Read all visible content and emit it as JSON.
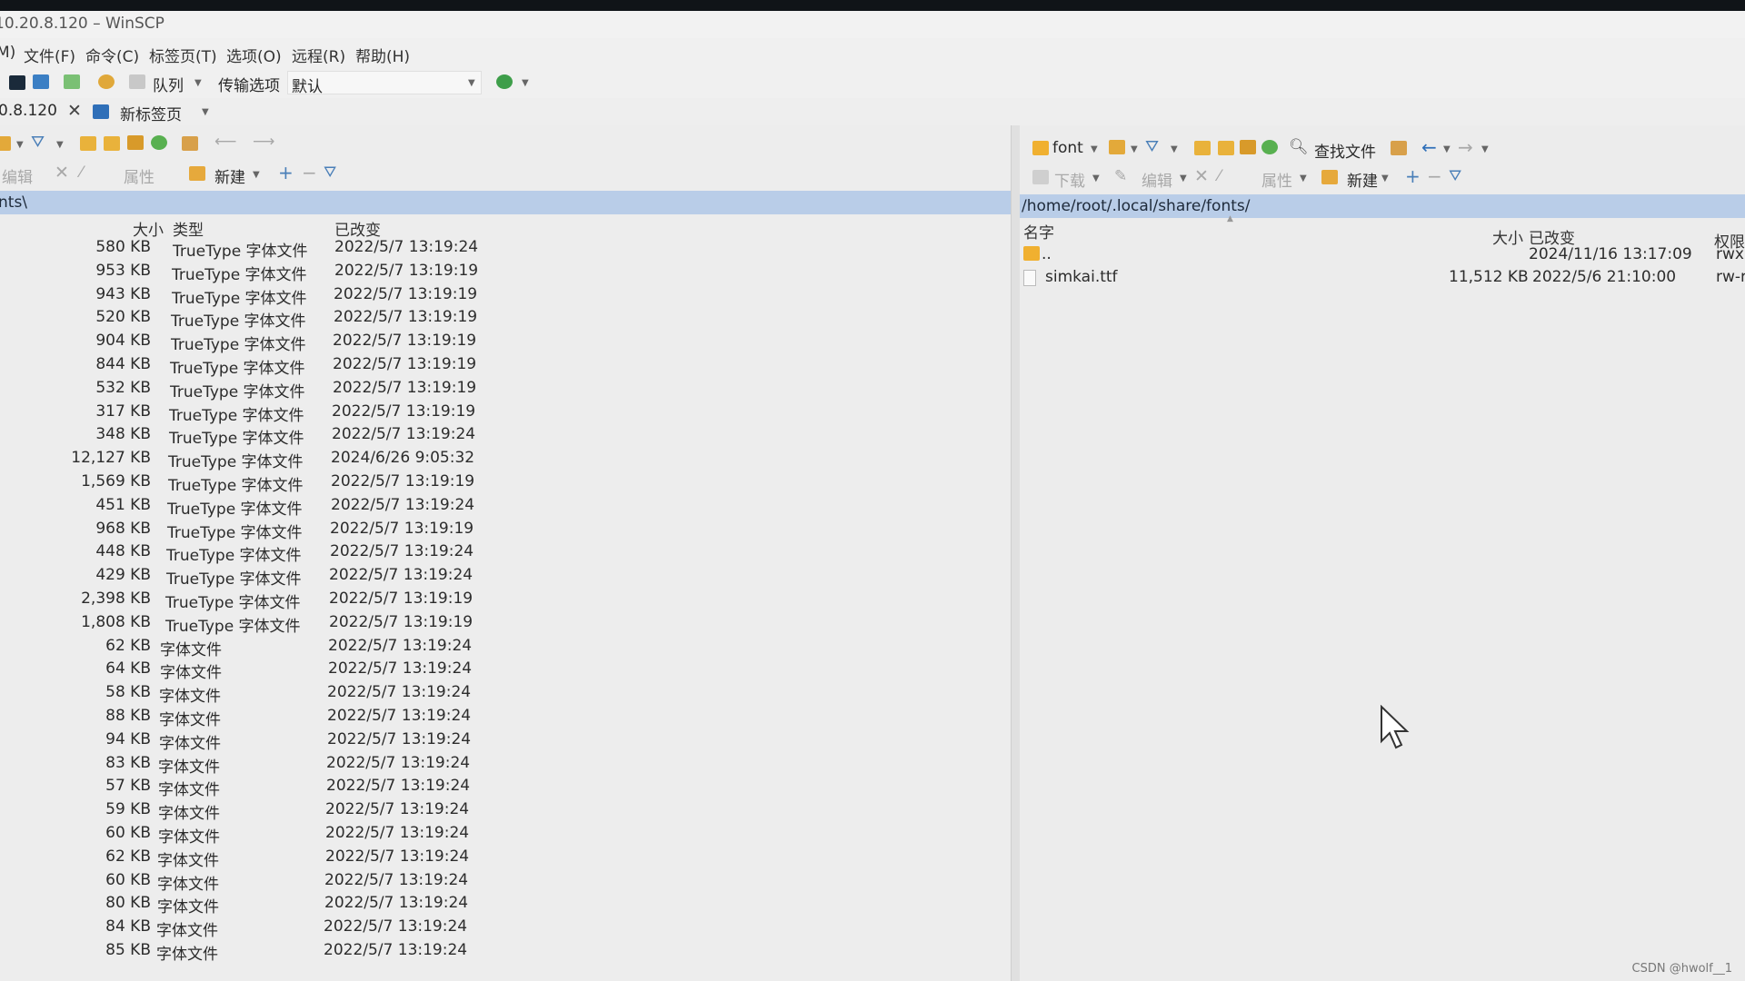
{
  "window": {
    "title": "10.20.8.120 – WinSCP"
  },
  "menu": [
    "M)",
    "文件(F)",
    "命令(C)",
    "标签页(T)",
    "选项(O)",
    "远程(R)",
    "帮助(H)"
  ],
  "toolbar": {
    "queue_label": "队列",
    "transfer_label": "传输选项",
    "transfer_value": "默认"
  },
  "tabs": {
    "session_label": "0.8.120",
    "new_tab_label": "新标签页"
  },
  "left": {
    "edit_label": "编辑",
    "props_label": "属性",
    "new_label": "新建",
    "path": "nts\\",
    "headers": {
      "size": "大小",
      "type": "类型",
      "changed": "已改变"
    },
    "files": [
      {
        "size": "580 KB",
        "type": "TrueType 字体文件",
        "changed": "2022/5/7 13:19:24"
      },
      {
        "size": "953 KB",
        "type": "TrueType 字体文件",
        "changed": "2022/5/7 13:19:19"
      },
      {
        "size": "943 KB",
        "type": "TrueType 字体文件",
        "changed": "2022/5/7 13:19:19"
      },
      {
        "size": "520 KB",
        "type": "TrueType 字体文件",
        "changed": "2022/5/7 13:19:19"
      },
      {
        "size": "904 KB",
        "type": "TrueType 字体文件",
        "changed": "2022/5/7 13:19:19"
      },
      {
        "size": "844 KB",
        "type": "TrueType 字体文件",
        "changed": "2022/5/7 13:19:19"
      },
      {
        "size": "532 KB",
        "type": "TrueType 字体文件",
        "changed": "2022/5/7 13:19:19"
      },
      {
        "size": "317 KB",
        "type": "TrueType 字体文件",
        "changed": "2022/5/7 13:19:19"
      },
      {
        "size": "348 KB",
        "type": "TrueType 字体文件",
        "changed": "2022/5/7 13:19:24"
      },
      {
        "size": "12,127 KB",
        "type": "TrueType 字体文件",
        "changed": "2024/6/26 9:05:32"
      },
      {
        "size": "1,569 KB",
        "type": "TrueType 字体文件",
        "changed": "2022/5/7 13:19:19"
      },
      {
        "size": "451 KB",
        "type": "TrueType 字体文件",
        "changed": "2022/5/7 13:19:24"
      },
      {
        "size": "968 KB",
        "type": "TrueType 字体文件",
        "changed": "2022/5/7 13:19:19"
      },
      {
        "size": "448 KB",
        "type": "TrueType 字体文件",
        "changed": "2022/5/7 13:19:24"
      },
      {
        "size": "429 KB",
        "type": "TrueType 字体文件",
        "changed": "2022/5/7 13:19:24"
      },
      {
        "size": "2,398 KB",
        "type": "TrueType 字体文件",
        "changed": "2022/5/7 13:19:19"
      },
      {
        "size": "1,808 KB",
        "type": "TrueType 字体文件",
        "changed": "2022/5/7 13:19:19"
      },
      {
        "size": "62 KB",
        "type": "字体文件",
        "changed": "2022/5/7 13:19:24"
      },
      {
        "size": "64 KB",
        "type": "字体文件",
        "changed": "2022/5/7 13:19:24"
      },
      {
        "size": "58 KB",
        "type": "字体文件",
        "changed": "2022/5/7 13:19:24"
      },
      {
        "size": "88 KB",
        "type": "字体文件",
        "changed": "2022/5/7 13:19:24"
      },
      {
        "size": "94 KB",
        "type": "字体文件",
        "changed": "2022/5/7 13:19:24"
      },
      {
        "size": "83 KB",
        "type": "字体文件",
        "changed": "2022/5/7 13:19:24"
      },
      {
        "size": "57 KB",
        "type": "字体文件",
        "changed": "2022/5/7 13:19:24"
      },
      {
        "size": "59 KB",
        "type": "字体文件",
        "changed": "2022/5/7 13:19:24"
      },
      {
        "size": "60 KB",
        "type": "字体文件",
        "changed": "2022/5/7 13:19:24"
      },
      {
        "size": "62 KB",
        "type": "字体文件",
        "changed": "2022/5/7 13:19:24"
      },
      {
        "size": "60 KB",
        "type": "字体文件",
        "changed": "2022/5/7 13:19:24"
      },
      {
        "size": "80 KB",
        "type": "字体文件",
        "changed": "2022/5/7 13:19:24"
      },
      {
        "size": "84 KB",
        "type": "字体文件",
        "changed": "2022/5/7 13:19:24"
      },
      {
        "size": "85 KB",
        "type": "字体文件",
        "changed": "2022/5/7 13:19:24"
      }
    ]
  },
  "right": {
    "folder_label": "font",
    "find_label": "查找文件",
    "download_label": "下载",
    "edit_label": "编辑",
    "props_label": "属性",
    "new_label": "新建",
    "path": "/home/root/.local/share/fonts/",
    "headers": {
      "name": "名字",
      "size": "大小",
      "changed": "已改变",
      "rights": "权限"
    },
    "parent": {
      "name": "..",
      "changed": "2024/11/16 13:17:09",
      "rights": "rwxr"
    },
    "files": [
      {
        "name": "simkai.ttf",
        "size": "11,512 KB",
        "changed": "2022/5/6 21:10:00",
        "rights": "rw-r"
      }
    ]
  },
  "watermark": "CSDN @hwolf__1",
  "colors": {
    "path_bg": "#b9cde8",
    "folder": "#f0b030"
  }
}
